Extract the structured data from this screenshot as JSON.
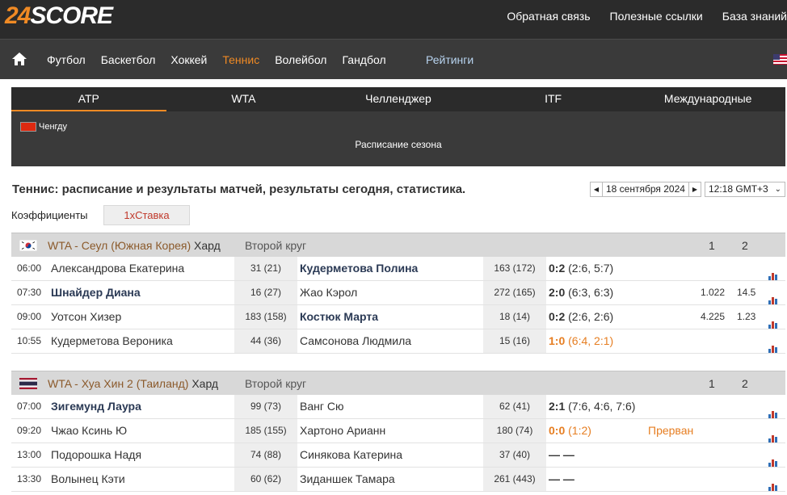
{
  "logo": {
    "num": "24",
    "word": "SCORE"
  },
  "top_links": [
    "Обратная связь",
    "Полезные ссылки",
    "База знаний"
  ],
  "sports": [
    "Футбол",
    "Баскетбол",
    "Хоккей",
    "Теннис",
    "Волейбол",
    "Гандбол"
  ],
  "active_sport": "Теннис",
  "ratings_label": "Рейтинги",
  "sub_tabs": [
    "ATP",
    "WTA",
    "Челленджер",
    "ITF",
    "Международные"
  ],
  "active_sub_tab": "ATP",
  "featured_tournament": "Ченгду",
  "season_link": "Расписание сезона",
  "page_title": "Теннис: расписание и результаты матчей, результаты сегодня, статистика.",
  "date_label": "18 сентября 2024",
  "time_label": "12:18 GMT+3",
  "odds_label": "Коэффициенты",
  "bookmaker": "1хСтавка",
  "colors": {
    "accent": "#f08a24",
    "dark": "#2b2b2b",
    "winner": "#2b3a55"
  },
  "tournaments": [
    {
      "name": "WTA - Сеул (Южная Корея)",
      "surface": "Хард",
      "round": "Второй круг",
      "flag": "korea-flag",
      "col1": "1",
      "col2": "2",
      "matches": [
        {
          "time": "06:00",
          "p1": "Александрова Екатерина",
          "r1": "31 (21)",
          "p2": "Кудерметова Полина",
          "r2": "163 (172)",
          "score_main": "0:2",
          "score_sets": "(2:6, 5:7)",
          "status": "",
          "o1": "",
          "o2": "",
          "winner": 2,
          "live": false
        },
        {
          "time": "07:30",
          "p1": "Шнайдер Диана",
          "r1": "16 (27)",
          "p2": "Жао Кэрол",
          "r2": "272 (165)",
          "score_main": "2:0",
          "score_sets": "(6:3, 6:3)",
          "status": "",
          "o1": "1.022",
          "o2": "14.5",
          "winner": 1,
          "live": false
        },
        {
          "time": "09:00",
          "p1": "Уотсон Хизер",
          "r1": "183 (158)",
          "p2": "Костюк Марта",
          "r2": "18 (14)",
          "score_main": "0:2",
          "score_sets": "(2:6, 2:6)",
          "status": "",
          "o1": "4.225",
          "o2": "1.23",
          "winner": 2,
          "live": false
        },
        {
          "time": "10:55",
          "p1": "Кудерметова Вероника",
          "r1": "44 (36)",
          "p2": "Самсонова Людмила",
          "r2": "15 (16)",
          "score_main": "1:0",
          "score_sets": "(6:4, 2:1)",
          "status": "",
          "o1": "",
          "o2": "",
          "winner": 0,
          "live": true
        }
      ]
    },
    {
      "name": "WTA - Хуа Хин 2 (Таиланд)",
      "surface": "Хард",
      "round": "Второй круг",
      "flag": "thailand-flag",
      "col1": "1",
      "col2": "2",
      "matches": [
        {
          "time": "07:00",
          "p1": "Зигемунд Лаура",
          "r1": "99 (73)",
          "p2": "Ванг Сю",
          "r2": "62 (41)",
          "score_main": "2:1",
          "score_sets": "(7:6, 4:6, 7:6)",
          "status": "",
          "o1": "",
          "o2": "",
          "winner": 1,
          "live": false
        },
        {
          "time": "09:20",
          "p1": "Чжао Ксинь Ю",
          "r1": "185 (155)",
          "p2": "Хартоно Арианн",
          "r2": "180 (74)",
          "score_main": "0:0",
          "score_sets": "(1:2)",
          "status": "Прерван",
          "o1": "",
          "o2": "",
          "winner": 0,
          "live": true
        },
        {
          "time": "13:00",
          "p1": "Подорошка Надя",
          "r1": "74 (88)",
          "p2": "Синякова Катерина",
          "r2": "37 (40)",
          "score_main": "— —",
          "score_sets": "",
          "status": "",
          "o1": "",
          "o2": "",
          "winner": 0,
          "live": false
        },
        {
          "time": "13:30",
          "p1": "Волынец Кэти",
          "r1": "60 (62)",
          "p2": "Зиданшек Тамара",
          "r2": "261 (443)",
          "score_main": "— —",
          "score_sets": "",
          "status": "",
          "o1": "",
          "o2": "",
          "winner": 0,
          "live": false
        }
      ]
    }
  ]
}
